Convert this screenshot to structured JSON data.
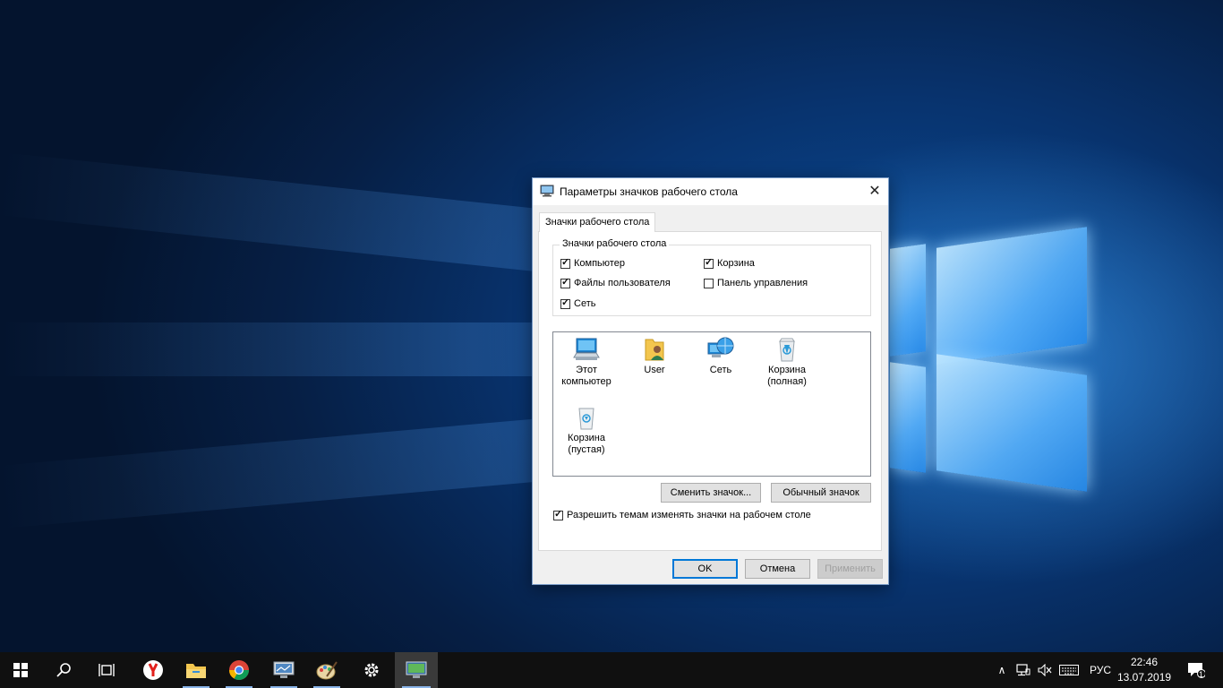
{
  "dialog": {
    "title": "Параметры значков рабочего стола",
    "tab": "Значки рабочего стола",
    "group_title": "Значки рабочего стола",
    "checkboxes": [
      {
        "label": "Компьютер",
        "checked": true
      },
      {
        "label": "Корзина",
        "checked": true
      },
      {
        "label": "Файлы пользователя",
        "checked": true
      },
      {
        "label": "Панель управления",
        "checked": false
      },
      {
        "label": "Сеть",
        "checked": true
      }
    ],
    "icons": [
      {
        "line1": "Этот",
        "line2": "компьютер",
        "icon": "computer-icon"
      },
      {
        "line1": "User",
        "line2": "",
        "icon": "user-folder-icon"
      },
      {
        "line1": "Сеть",
        "line2": "",
        "icon": "network-icon"
      },
      {
        "line1": "Корзина",
        "line2": "(полная)",
        "icon": "recycle-bin-full-icon"
      },
      {
        "line1": "Корзина",
        "line2": "(пустая)",
        "icon": "recycle-bin-empty-icon"
      }
    ],
    "change_icon_button": "Сменить значок...",
    "restore_default_button": "Обычный значок",
    "allow_themes": {
      "label": "Разрешить темам изменять значки на рабочем столе",
      "checked": true
    },
    "ok_button": "OK",
    "cancel_button": "Отмена",
    "apply_button": "Применить"
  },
  "taskbar": {
    "apps": [
      "start-icon",
      "search-icon",
      "task-view-icon",
      "yandex-browser-icon",
      "file-explorer-icon",
      "chrome-icon",
      "monitor-app-icon",
      "paint-icon",
      "settings-icon",
      "desktop-icons-dialog-icon"
    ],
    "language": "РУС",
    "time": "22:46",
    "date": "13.07.2019",
    "notification_count": "1"
  },
  "colors": {
    "accent": "#0078d7",
    "taskbar": "#101010",
    "wallpaper": "#0a3a78"
  }
}
